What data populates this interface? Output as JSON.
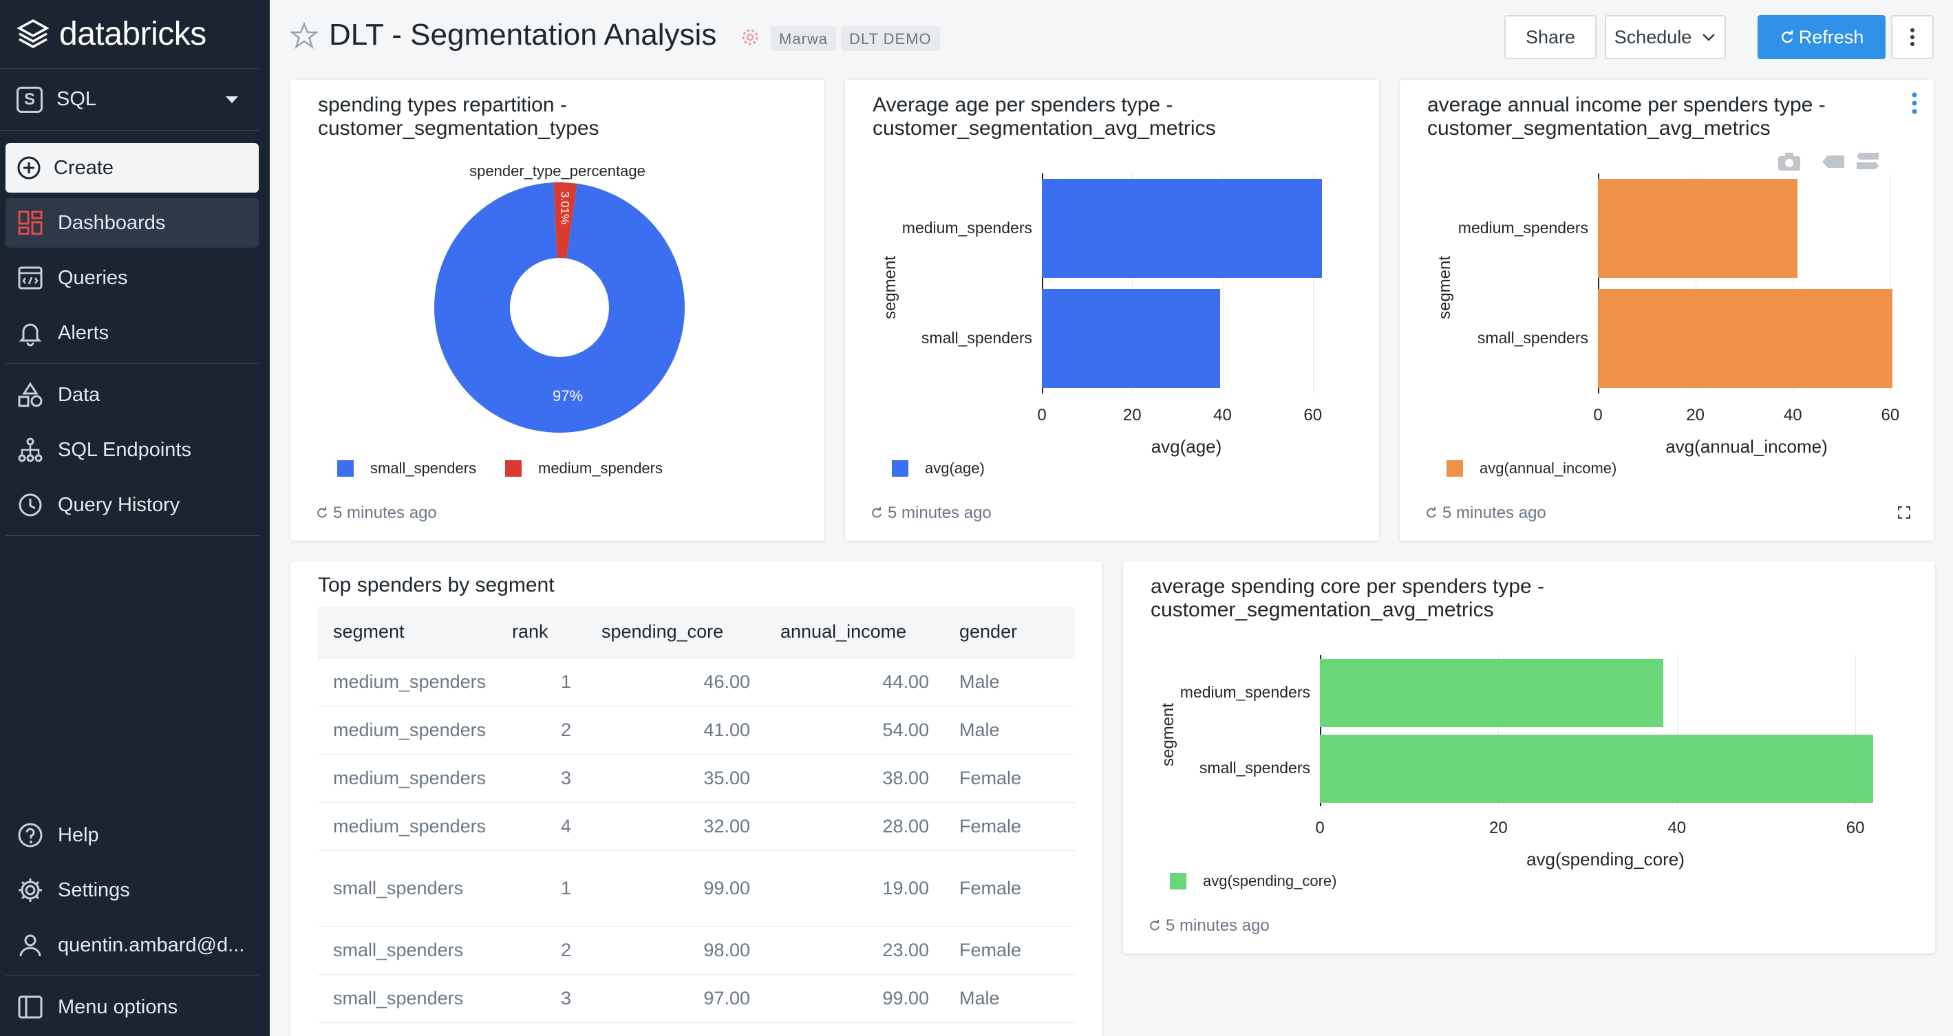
{
  "app": {
    "brand": "databricks",
    "persona": "SQL"
  },
  "sidebar": {
    "create_label": "Create",
    "items": [
      {
        "label": "Dashboards",
        "icon": "dashboards-icon"
      },
      {
        "label": "Queries",
        "icon": "queries-icon"
      },
      {
        "label": "Alerts",
        "icon": "bell-icon"
      },
      {
        "label": "Data",
        "icon": "data-icon"
      },
      {
        "label": "SQL Endpoints",
        "icon": "endpoints-icon"
      },
      {
        "label": "Query History",
        "icon": "history-icon"
      }
    ],
    "bottom": [
      {
        "label": "Help",
        "icon": "help-icon"
      },
      {
        "label": "Settings",
        "icon": "gear-icon"
      },
      {
        "label": "quentin.ambard@d...",
        "icon": "user-icon"
      },
      {
        "label": "Menu options",
        "icon": "menu-icon"
      }
    ]
  },
  "header": {
    "title": "DLT - Segmentation Analysis",
    "tags": [
      "Marwa",
      "DLT DEMO"
    ],
    "share_label": "Share",
    "schedule_label": "Schedule",
    "refresh_label": "Refresh"
  },
  "colors": {
    "blue": "#3b6ff0",
    "red": "#d93b30",
    "orange": "#f0914a",
    "green": "#6ad67a",
    "accent": "#2f91e8"
  },
  "widgets": {
    "pie": {
      "title_line1": "spending types repartition -",
      "title_line2": "customer_segmentation_types",
      "label": "spender_type_percentage",
      "updated": "5 minutes ago"
    },
    "age": {
      "title_line1": "Average age per spenders type -",
      "title_line2": "customer_segmentation_avg_metrics",
      "updated": "5 minutes ago"
    },
    "income": {
      "title_line1": "average annual income per spenders type -",
      "title_line2": "customer_segmentation_avg_metrics",
      "updated": "5 minutes ago"
    },
    "table": {
      "title": "Top spenders by segment",
      "columns": [
        "segment",
        "rank",
        "spending_core",
        "annual_income",
        "gender"
      ],
      "rows": [
        [
          "medium_spenders",
          "1",
          "46.00",
          "44.00",
          "Male"
        ],
        [
          "medium_spenders",
          "2",
          "41.00",
          "54.00",
          "Male"
        ],
        [
          "medium_spenders",
          "3",
          "35.00",
          "38.00",
          "Female"
        ],
        [
          "medium_spenders",
          "4",
          "32.00",
          "28.00",
          "Female"
        ],
        [
          "small_spenders",
          "1",
          "99.00",
          "19.00",
          "Female"
        ],
        [
          "small_spenders",
          "2",
          "98.00",
          "23.00",
          "Female"
        ],
        [
          "small_spenders",
          "3",
          "97.00",
          "99.00",
          "Male"
        ]
      ]
    },
    "spending": {
      "title_line1": "average spending core per spenders type -",
      "title_line2": "customer_segmentation_avg_metrics",
      "updated": "5 minutes ago"
    }
  },
  "chart_data": [
    {
      "type": "pie",
      "title": "spending types repartition - customer_segmentation_types",
      "series_label": "spender_type_percentage",
      "categories": [
        "small_spenders",
        "medium_spenders"
      ],
      "values": [
        97,
        3.01
      ],
      "labels": [
        "97%",
        "3.01%"
      ],
      "colors": [
        "#3b6ff0",
        "#d93b30"
      ]
    },
    {
      "type": "bar",
      "orientation": "horizontal",
      "title": "Average age per spenders type - customer_segmentation_avg_metrics",
      "categories": [
        "medium_spenders",
        "small_spenders"
      ],
      "series": [
        {
          "name": "avg(age)",
          "values": [
            62,
            39.5
          ]
        }
      ],
      "xlabel": "avg(age)",
      "ylabel": "segment",
      "xticks": [
        "0",
        "20",
        "40",
        "60"
      ],
      "xlim": [
        0,
        64
      ],
      "color": "#3b6ff0"
    },
    {
      "type": "bar",
      "orientation": "horizontal",
      "title": "average annual income per spenders type - customer_segmentation_avg_metrics",
      "categories": [
        "medium_spenders",
        "small_spenders"
      ],
      "series": [
        {
          "name": "avg(annual_income)",
          "values": [
            41,
            60.5
          ]
        }
      ],
      "xlabel": "avg(annual_income)",
      "ylabel": "segment",
      "xticks": [
        "0",
        "20",
        "40",
        "60"
      ],
      "xlim": [
        0,
        61
      ],
      "color": "#f0914a"
    },
    {
      "type": "bar",
      "orientation": "horizontal",
      "title": "average spending core per spenders type - customer_segmentation_avg_metrics",
      "categories": [
        "medium_spenders",
        "small_spenders"
      ],
      "series": [
        {
          "name": "avg(spending_core)",
          "values": [
            38.5,
            62
          ]
        }
      ],
      "xlabel": "avg(spending_core)",
      "ylabel": "segment",
      "xticks": [
        "0",
        "20",
        "40",
        "60"
      ],
      "xlim": [
        0,
        64
      ],
      "color": "#6ad67a"
    }
  ]
}
